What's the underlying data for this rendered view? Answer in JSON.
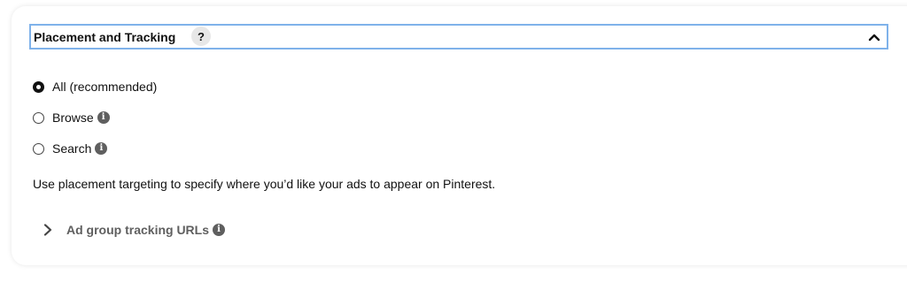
{
  "section": {
    "title": "Placement and Tracking",
    "help_glyph": "?",
    "help_icon": "question-mark-icon",
    "collapse_icon": "chevron-up-icon"
  },
  "placement_options": [
    {
      "label": "All (recommended)",
      "selected": true,
      "has_info": false
    },
    {
      "label": "Browse",
      "selected": false,
      "has_info": true
    },
    {
      "label": "Search",
      "selected": false,
      "has_info": true
    }
  ],
  "hint_text": "Use placement targeting to specify where you’d like your ads to appear on Pinterest.",
  "tracking": {
    "label": "Ad group tracking URLs",
    "expand_icon": "chevron-right-icon",
    "has_info": true
  },
  "info_glyph": "i",
  "colors": {
    "focus_border": "#7fb2ea",
    "text": "#111111",
    "muted_text": "#5f5f5f",
    "help_bg": "#e7e7e7"
  }
}
